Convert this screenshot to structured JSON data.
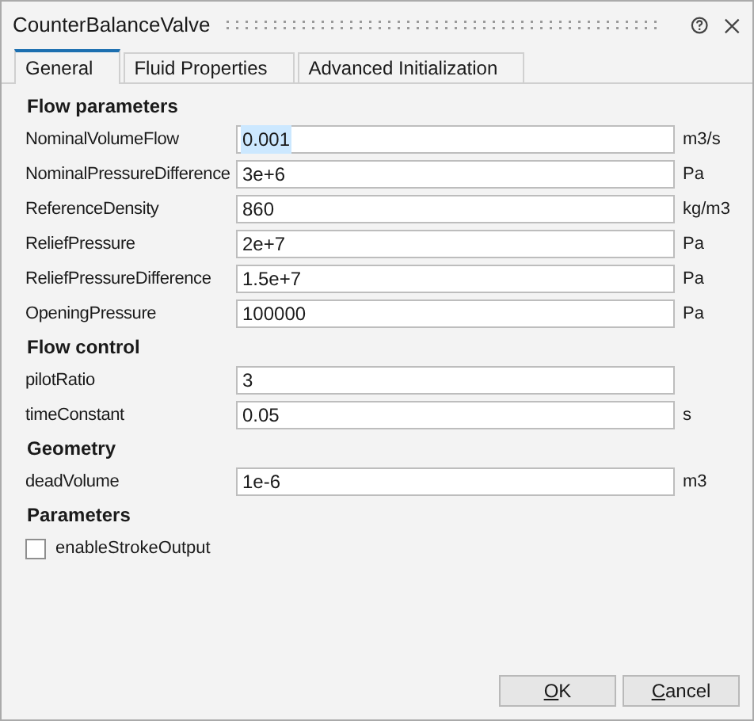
{
  "window": {
    "title": "CounterBalanceValve"
  },
  "tabs": [
    {
      "label": "General",
      "selected": true
    },
    {
      "label": "Fluid Properties",
      "selected": false
    },
    {
      "label": "Advanced Initialization",
      "selected": false
    }
  ],
  "sections": [
    {
      "heading": "Flow parameters",
      "items": [
        {
          "kind": "field",
          "label": "NominalVolumeFlow",
          "value": "0.001",
          "unit": "m3/s",
          "selected": true
        },
        {
          "kind": "field",
          "label": "NominalPressureDifference",
          "value": "3e+6",
          "unit": "Pa",
          "selected": false
        },
        {
          "kind": "field",
          "label": "ReferenceDensity",
          "value": "860",
          "unit": "kg/m3",
          "selected": false
        },
        {
          "kind": "field",
          "label": "ReliefPressure",
          "value": "2e+7",
          "unit": "Pa",
          "selected": false
        },
        {
          "kind": "field",
          "label": "ReliefPressureDifference",
          "value": "1.5e+7",
          "unit": "Pa",
          "selected": false
        },
        {
          "kind": "field",
          "label": "OpeningPressure",
          "value": "100000",
          "unit": "Pa",
          "selected": false
        }
      ]
    },
    {
      "heading": "Flow control",
      "items": [
        {
          "kind": "field",
          "label": "pilotRatio",
          "value": "3",
          "selected": false
        },
        {
          "kind": "field",
          "label": "timeConstant",
          "value": "0.05",
          "unit": "s",
          "selected": false
        }
      ]
    },
    {
      "heading": "Geometry",
      "items": [
        {
          "kind": "field",
          "label": "deadVolume",
          "value": "1e-6",
          "unit": "m3",
          "selected": false
        }
      ]
    },
    {
      "heading": "Parameters",
      "items": [
        {
          "kind": "checkbox",
          "label": "enableStrokeOutput",
          "checked": false
        }
      ]
    }
  ],
  "buttons": [
    {
      "label": "OK",
      "underline_first": true
    },
    {
      "label": "Cancel",
      "underline_first": true
    }
  ]
}
